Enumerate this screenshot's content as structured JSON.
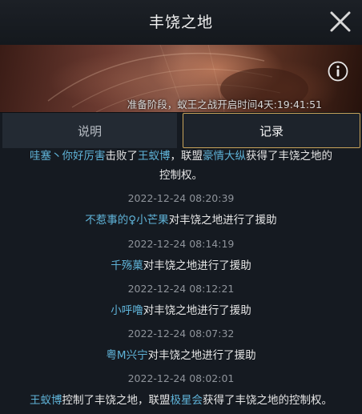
{
  "header": {
    "title": "丰饶之地",
    "close_icon": "close-icon"
  },
  "banner": {
    "info_icon": "info-icon",
    "status_text": "准备阶段，蚁王之战开启时间4天:19:41:51"
  },
  "tabs": [
    {
      "label": "说明",
      "active": false
    },
    {
      "label": "记录",
      "active": true
    }
  ],
  "colors": {
    "name": "#5fb3d8",
    "tab_border": "#c9a45a",
    "background": "#151a21"
  },
  "log": {
    "partial_top": {
      "line1_name1": "哇塞丶你好厉害",
      "line1_text1": "击败了",
      "line1_name2": "王蚁博",
      "line1_text2": "，联盟",
      "line1_name3": "豪情大纵",
      "line1_text3": "获得了丰饶之地的",
      "line2_text": "控制权。"
    },
    "entries": [
      {
        "time": "2022-12-24 08:20:39",
        "name": "不惹事的♀小芒果",
        "text": "对丰饶之地进行了援助"
      },
      {
        "time": "2022-12-24 08:14:19",
        "name": "千殇菓",
        "text": "对丰饶之地进行了援助"
      },
      {
        "time": "2022-12-24 08:12:21",
        "name": "小呼噜",
        "text": "对丰饶之地进行了援助"
      },
      {
        "time": "2022-12-24 08:07:32",
        "name": "粤M兴宁",
        "text": "对丰饶之地进行了援助"
      }
    ],
    "last": {
      "time": "2022-12-24 08:02:01",
      "name1": "王蚁博",
      "text1": "控制了丰饶之地，联盟",
      "name2": "极星会",
      "text2": "获得了丰饶之地的控制权。"
    }
  }
}
